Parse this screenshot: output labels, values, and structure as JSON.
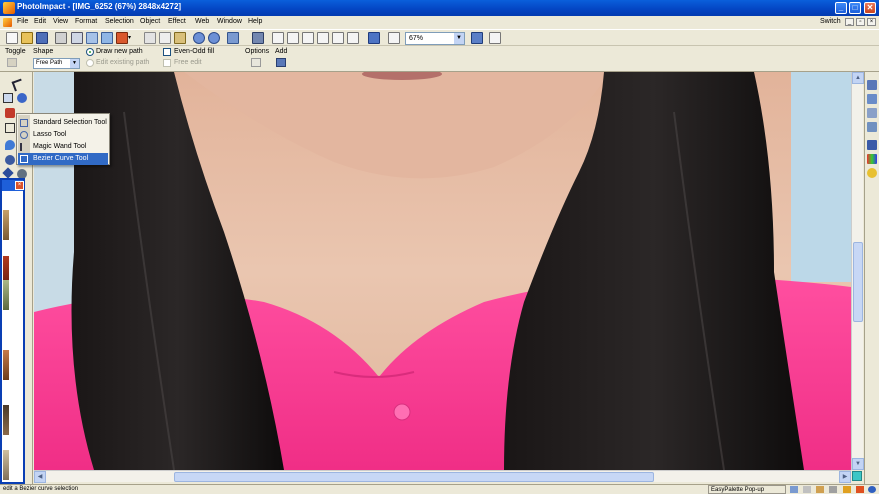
{
  "window": {
    "title": "PhotoImpact - [IMG_6252 (67%) 2848x4272]",
    "min": "_",
    "max": "□",
    "close": "✕"
  },
  "menu": {
    "items": [
      "File",
      "Edit",
      "View",
      "Format",
      "Selection",
      "Object",
      "Effect",
      "Web",
      "Window",
      "Help"
    ],
    "switch_label": "Switch"
  },
  "toolbar": {
    "zoom_value": "67%"
  },
  "attributes": {
    "toggle_label": "Toggle",
    "shape_label": "Shape",
    "shape_value": "Free Path",
    "draw_new_path": "Draw new path",
    "edit_existing_path": "Edit existing path",
    "even_odd_fill": "Even-Odd fill",
    "free_edit": "Free edit",
    "options_label": "Options",
    "add_label": "Add"
  },
  "flyout": {
    "items": [
      "Standard Selection Tool",
      "Lasso Tool",
      "Magic Wand Tool",
      "Bezier Curve Tool"
    ],
    "selected_index": 3
  },
  "status": {
    "text": "edit a Bezier curve selection",
    "easypalette": "EasyPalette Pop-up"
  },
  "colors": {
    "titlebar": "#0a5fdb",
    "chrome": "#ece9d8",
    "selection": "#316ac5",
    "shirt": "#ff3d97",
    "hair": "#0f0d0d",
    "skin": "#e9c2ac",
    "background_wall": "#bcd8e8"
  }
}
